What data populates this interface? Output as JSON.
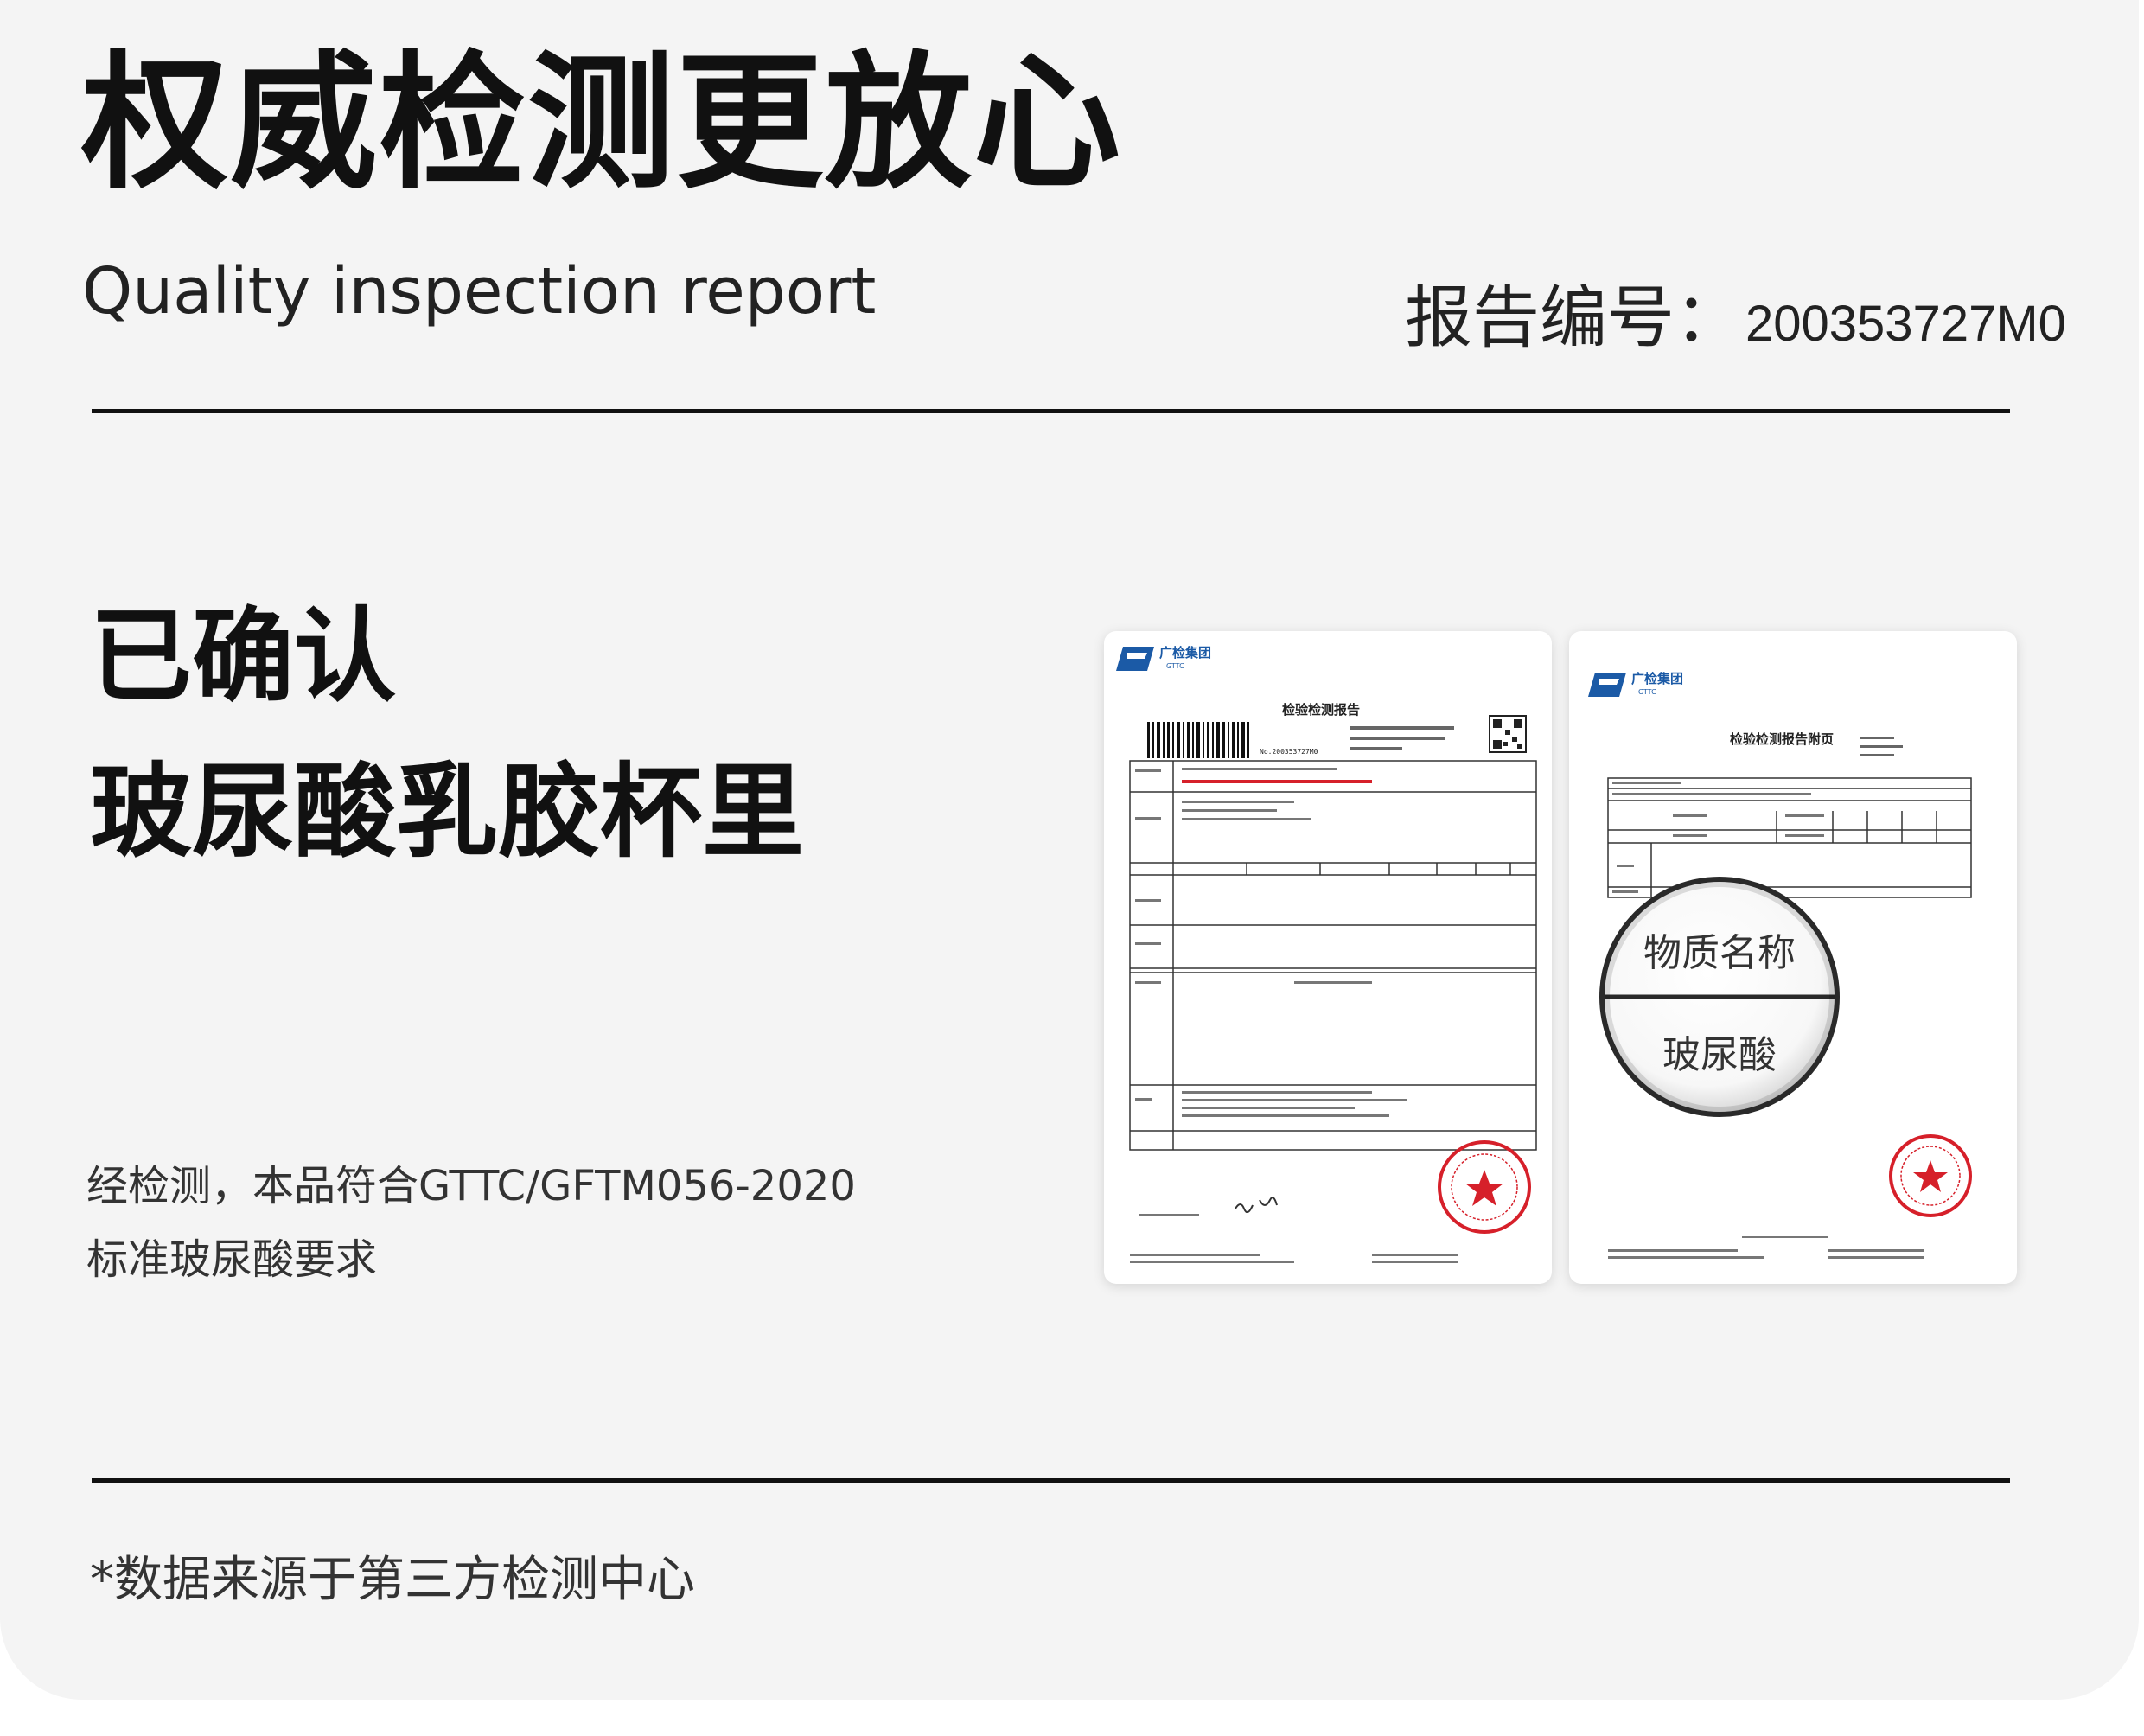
{
  "header": {
    "title": "权威检测更放心",
    "subtitle": "Quality inspection report",
    "report_number_label": "报告编号：",
    "report_number_value": "200353727M0"
  },
  "main": {
    "confirm_label": "已确认",
    "product_name": "玻尿酸乳胶杯里",
    "description_line1": "经检测，本品符合GTTC/GFTM056-2020",
    "description_line2": "标准玻尿酸要求"
  },
  "documents": {
    "logo_name": "广检集团",
    "logo_abbr": "GTTC",
    "left_doc_title": "检验检测报告",
    "left_report_code": "No.200353727M0",
    "right_doc_title": "检验检测报告附页",
    "magnifier_label": "物质名称",
    "magnifier_value": "玻尿酸"
  },
  "footer": {
    "footnote": "*数据来源于第三方检测中心"
  },
  "colors": {
    "background": "#f4f4f4",
    "stamp": "#d6202a",
    "logo": "#1b5aa6",
    "text": "#111111"
  }
}
